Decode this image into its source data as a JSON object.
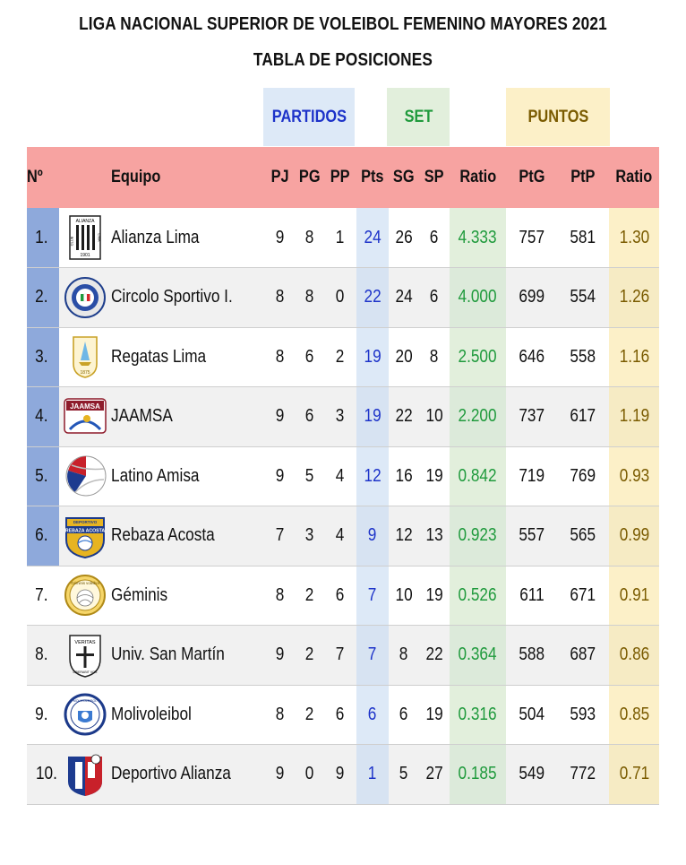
{
  "title": "LIGA NACIONAL SUPERIOR DE VOLEIBOL FEMENINO MAYORES 2021",
  "subtitle": "TABLA DE POSICIONES",
  "groups": {
    "partidos": "PARTIDOS",
    "set": "SET",
    "puntos": "PUNTOS"
  },
  "columns": {
    "no": "Nº",
    "equipo": "Equipo",
    "pj": "PJ",
    "pg": "PG",
    "pp": "PP",
    "pts": "Pts",
    "sg": "SG",
    "sp": "SP",
    "ratio_set": "Ratio",
    "ptg": "PtG",
    "ptp": "PtP",
    "ratio_pts": "Ratio"
  },
  "logo_text": {
    "alianza_top": "ALIANZA",
    "alianza_club": "CLUB",
    "alianza_lima": "LIMA",
    "alianza_year": "1901",
    "regatas_year": "1875",
    "jaamsa": "JAAMSA",
    "rebaza_top": "DEPORTIVO",
    "rebaza_band": "REBAZA ACOSTA",
    "geminis": "Géminis voleibol",
    "veritas": "VERITAS",
    "liberabit": "LIBERABIT VOS",
    "molivoleibol": "MOLIVOLEIBOL"
  },
  "colors": {
    "header_row": "#f7a3a1",
    "top_positions": "#8ea9db",
    "pts_column": "#dde9f7",
    "set_ratio_column": "#e2efdc",
    "points_ratio_column": "#fcf0c8"
  },
  "rows": [
    {
      "pos": "1.",
      "logo": "alianza-lima-logo",
      "team": "Alianza Lima",
      "pj": "9",
      "pg": "8",
      "pp": "1",
      "pts": "24",
      "sg": "26",
      "sp": "6",
      "ratio_set": "4.333",
      "ptg": "757",
      "ptp": "581",
      "ratio_pts": "1.30",
      "top": true
    },
    {
      "pos": "2.",
      "logo": "circolo-sportivo-logo",
      "team": "Circolo Sportivo I.",
      "pj": "8",
      "pg": "8",
      "pp": "0",
      "pts": "22",
      "sg": "24",
      "sp": "6",
      "ratio_set": "4.000",
      "ptg": "699",
      "ptp": "554",
      "ratio_pts": "1.26",
      "top": true
    },
    {
      "pos": "3.",
      "logo": "regatas-lima-logo",
      "team": "Regatas Lima",
      "pj": "8",
      "pg": "6",
      "pp": "2",
      "pts": "19",
      "sg": "20",
      "sp": "8",
      "ratio_set": "2.500",
      "ptg": "646",
      "ptp": "558",
      "ratio_pts": "1.16",
      "top": true
    },
    {
      "pos": "4.",
      "logo": "jaamsa-logo",
      "team": "JAAMSA",
      "pj": "9",
      "pg": "6",
      "pp": "3",
      "pts": "19",
      "sg": "22",
      "sp": "10",
      "ratio_set": "2.200",
      "ptg": "737",
      "ptp": "617",
      "ratio_pts": "1.19",
      "top": true
    },
    {
      "pos": "5.",
      "logo": "latino-amisa-logo",
      "team": "Latino Amisa",
      "pj": "9",
      "pg": "5",
      "pp": "4",
      "pts": "12",
      "sg": "16",
      "sp": "19",
      "ratio_set": "0.842",
      "ptg": "719",
      "ptp": "769",
      "ratio_pts": "0.93",
      "top": true
    },
    {
      "pos": "6.",
      "logo": "rebaza-acosta-logo",
      "team": "Rebaza Acosta",
      "pj": "7",
      "pg": "3",
      "pp": "4",
      "pts": "9",
      "sg": "12",
      "sp": "13",
      "ratio_set": "0.923",
      "ptg": "557",
      "ptp": "565",
      "ratio_pts": "0.99",
      "top": true
    },
    {
      "pos": "7.",
      "logo": "geminis-logo",
      "team": "Géminis",
      "pj": "8",
      "pg": "2",
      "pp": "6",
      "pts": "7",
      "sg": "10",
      "sp": "19",
      "ratio_set": "0.526",
      "ptg": "611",
      "ptp": "671",
      "ratio_pts": "0.91",
      "top": false
    },
    {
      "pos": "8.",
      "logo": "univ-san-martin-logo",
      "team": "Univ. San Martín",
      "pj": "9",
      "pg": "2",
      "pp": "7",
      "pts": "7",
      "sg": "8",
      "sp": "22",
      "ratio_set": "0.364",
      "ptg": "588",
      "ptp": "687",
      "ratio_pts": "0.86",
      "top": false
    },
    {
      "pos": "9.",
      "logo": "molivoleibol-logo",
      "team": "Molivoleibol",
      "pj": "8",
      "pg": "2",
      "pp": "6",
      "pts": "6",
      "sg": "6",
      "sp": "19",
      "ratio_set": "0.316",
      "ptg": "504",
      "ptp": "593",
      "ratio_pts": "0.85",
      "top": false
    },
    {
      "pos": "10.",
      "logo": "deportivo-alianza-logo",
      "team": "Deportivo Alianza",
      "pj": "9",
      "pg": "0",
      "pp": "9",
      "pts": "1",
      "sg": "5",
      "sp": "27",
      "ratio_set": "0.185",
      "ptg": "549",
      "ptp": "772",
      "ratio_pts": "0.71",
      "top": false
    }
  ]
}
